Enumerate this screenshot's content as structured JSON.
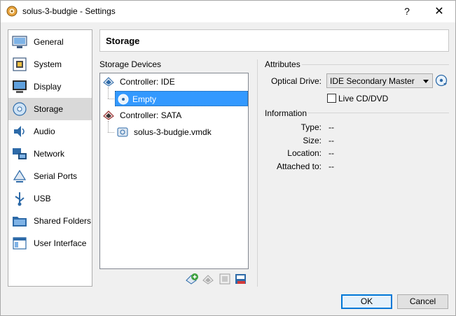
{
  "window": {
    "title": "solus-3-budgie - Settings",
    "help_glyph": "?",
    "close_glyph": "✕"
  },
  "sidebar": {
    "items": [
      {
        "label": "General",
        "icon": "general-icon"
      },
      {
        "label": "System",
        "icon": "system-icon"
      },
      {
        "label": "Display",
        "icon": "display-icon"
      },
      {
        "label": "Storage",
        "icon": "storage-icon",
        "selected": true
      },
      {
        "label": "Audio",
        "icon": "audio-icon"
      },
      {
        "label": "Network",
        "icon": "network-icon"
      },
      {
        "label": "Serial Ports",
        "icon": "serial-ports-icon"
      },
      {
        "label": "USB",
        "icon": "usb-icon"
      },
      {
        "label": "Shared Folders",
        "icon": "shared-folders-icon"
      },
      {
        "label": "User Interface",
        "icon": "user-interface-icon"
      }
    ]
  },
  "page": {
    "title": "Storage"
  },
  "storage_devices": {
    "title": "Storage Devices",
    "tree": [
      {
        "label": "Controller: IDE",
        "icon": "ide-controller-icon"
      },
      {
        "label": "Empty",
        "icon": "optical-disc-icon",
        "selected": true
      },
      {
        "label": "Controller: SATA",
        "icon": "sata-controller-icon"
      },
      {
        "label": "solus-3-budgie.vmdk",
        "icon": "hard-disk-icon"
      }
    ],
    "toolbar": [
      "add-attachment-icon",
      "remove-controller-icon",
      "add-controller-icon",
      "remove-attachment-icon"
    ]
  },
  "attributes": {
    "title": "Attributes",
    "optical_drive_label": "Optical Drive:",
    "optical_drive_value": "IDE Secondary Master",
    "live_cd_label": "Live CD/DVD",
    "live_cd_checked": false
  },
  "information": {
    "title": "Information",
    "rows": [
      {
        "label": "Type:",
        "value": "--"
      },
      {
        "label": "Size:",
        "value": "--"
      },
      {
        "label": "Location:",
        "value": "--"
      },
      {
        "label": "Attached to:",
        "value": "--"
      }
    ]
  },
  "buttons": {
    "ok": "OK",
    "cancel": "Cancel"
  },
  "colors": {
    "selection": "#3399ff",
    "accent": "#0078d7"
  }
}
